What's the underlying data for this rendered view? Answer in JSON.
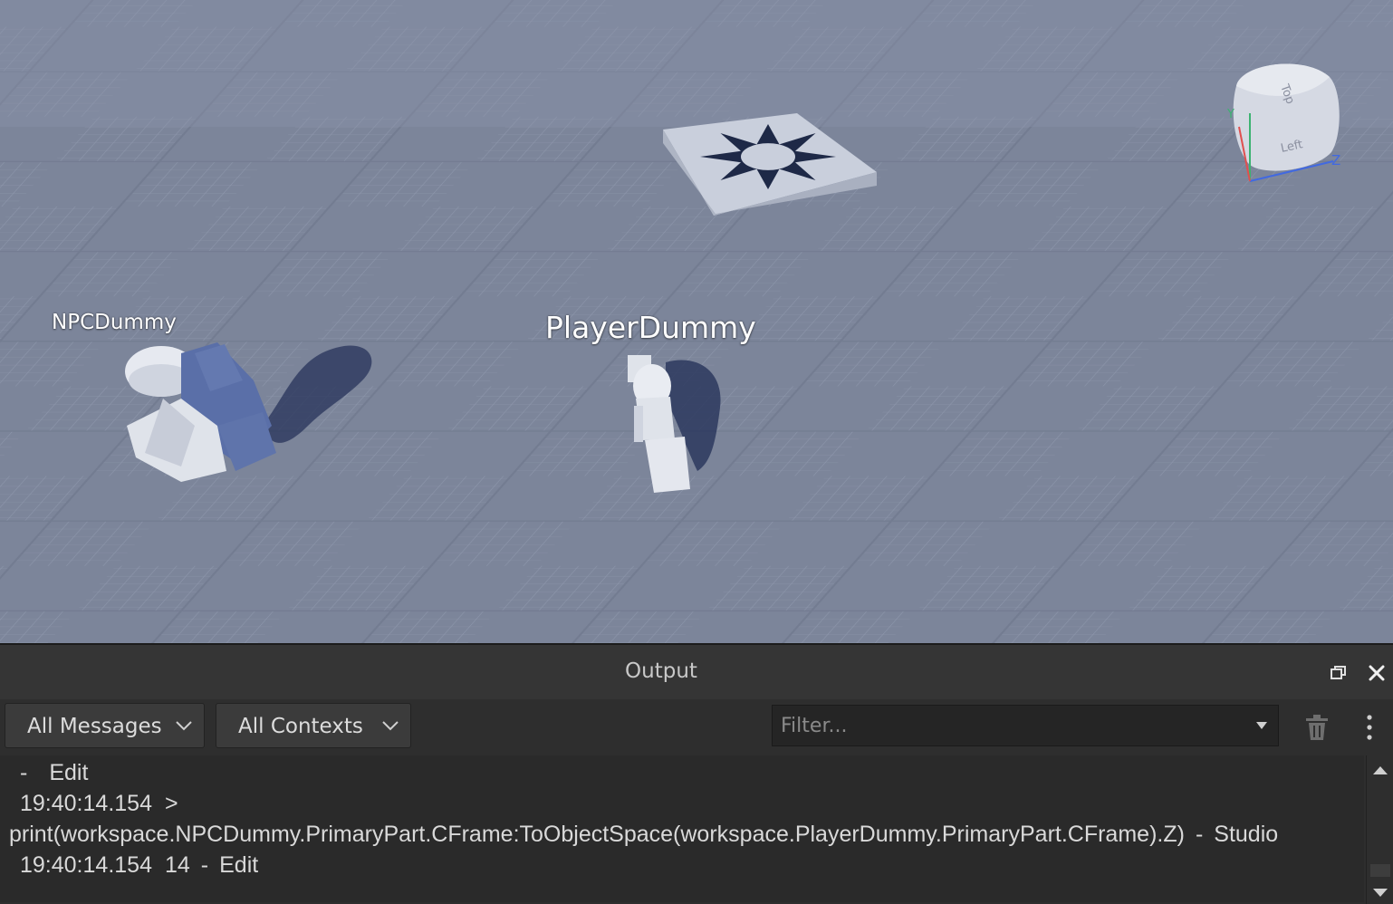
{
  "viewport": {
    "npc_label": "NPCDummy",
    "player_label": "PlayerDummy",
    "view_cube": {
      "top_face": "Top",
      "left_face": "Left",
      "axis_y": "Y",
      "axis_z": "Z"
    }
  },
  "output": {
    "title": "Output",
    "restore_icon": "restore-window-icon",
    "close_icon": "close-icon",
    "messages_dropdown": "All Messages",
    "contexts_dropdown": "All Contexts",
    "filter_placeholder": "Filter...",
    "log": [
      {
        "prefix": "-",
        "source": "Edit"
      },
      {
        "time": "19:40:14.154",
        "text": ">"
      },
      {
        "text": "print(workspace.NPCDummy.PrimaryPart.CFrame:ToObjectSpace(workspace.PlayerDummy.PrimaryPart.CFrame).Z)",
        "source": "Studio"
      },
      {
        "time": "19:40:14.154",
        "text": "14",
        "source": "Edit"
      }
    ]
  },
  "colors": {
    "baseplate": "#7f889d",
    "panel_bg": "#2e2e2e",
    "text": "#d9d9d9"
  }
}
